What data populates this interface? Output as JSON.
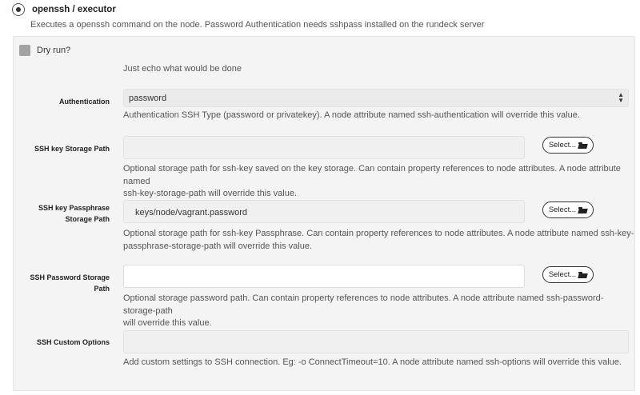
{
  "plugin": {
    "title": "openssh / executor",
    "description": "Executes a openssh command on the node. Password Authentication needs sshpass installed on the rundeck server"
  },
  "dry_run": {
    "label": "Dry run?",
    "help": "Just echo what would be done"
  },
  "authentication": {
    "label": "Authentication",
    "value": "password",
    "help": "Authentication SSH Type (password or privatekey). A node attribute named ssh-authentication will override this value."
  },
  "ssh_key_path": {
    "label": "SSH key Storage Path",
    "value": "",
    "button": "Select...",
    "help_line1": "Optional storage path for ssh-key saved on the key storage. Can contain property references to node attributes. A node attribute named",
    "help_line2": "ssh-key-storage-path will override this value."
  },
  "ssh_passphrase_path": {
    "label_line1": "SSH key Passphrase",
    "label_line2": "Storage Path",
    "value": "keys/node/vagrant.password",
    "button": "Select...",
    "help_line1": "Optional storage path for ssh-key Passphrase. Can contain property references to node attributes. A node attribute named ssh-key-",
    "help_line2": "passphrase-storage-path will override this value."
  },
  "ssh_password_path": {
    "label_line1": "SSH Password Storage",
    "label_line2": "Path",
    "value": "",
    "button": "Select...",
    "help_line1": "Optional storage password path. Can contain property references to node attributes. A node attribute named ssh-password-storage-path",
    "help_line2": "will override this value."
  },
  "ssh_custom_options": {
    "label": "SSH Custom Options",
    "value": "",
    "help": "Add custom settings to SSH connection. Eg: -o ConnectTimeout=10. A node attribute named ssh-options will override this value."
  },
  "icons": {
    "radio": "radio-selected-icon",
    "select_button": "folder-open-icon",
    "select_arrows": "sort-arrows-icon"
  }
}
